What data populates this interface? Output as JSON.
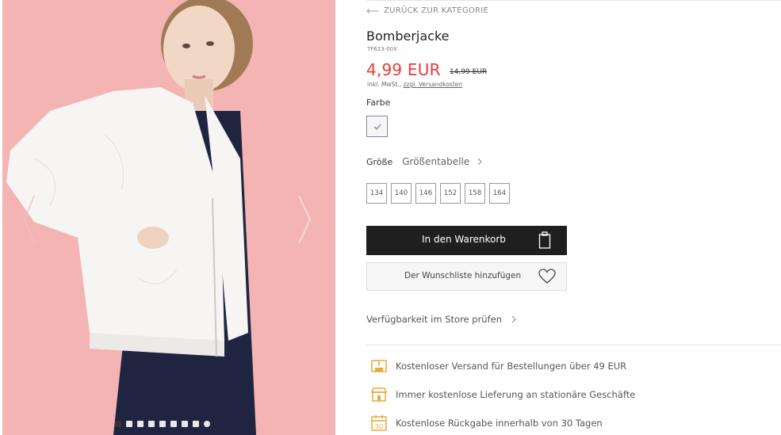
{
  "navigation": {
    "back_label": "ZURÜCK ZUR KATEGORIE"
  },
  "product": {
    "title": "Bomberjacke",
    "sku": "TF623-00X",
    "price": "4,99 EUR",
    "old_price": "14,99 EUR",
    "tax_text": "inkl. MwSt.,",
    "shipping_link": "zzgl. Versandkosten"
  },
  "color": {
    "label": "Farbe",
    "selected": "white"
  },
  "size": {
    "label": "Größe",
    "table_link": "Größentabelle",
    "options": [
      "134",
      "140",
      "146",
      "152",
      "158",
      "164"
    ]
  },
  "actions": {
    "add_to_cart": "In den Warenkorb",
    "add_to_wishlist": "Der Wunschliste hinzufügen",
    "store_availability": "Verfügbarkeit im Store prüfen"
  },
  "benefits": [
    {
      "icon": "truck-box-icon",
      "text": "Kostenloser Versand für Bestellungen über 49 EUR"
    },
    {
      "icon": "store-icon",
      "text": "Immer kostenlose Lieferung an stationäre Geschäfte"
    },
    {
      "icon": "calendar-30-icon",
      "text": "Kostenlose Rückgabe innerhalb von 30 Tagen"
    }
  ],
  "gallery": {
    "slide_count": 9,
    "active_index": 0
  },
  "colors": {
    "price_red": "#e83a3a",
    "icon_gold": "#e8a93a",
    "button_dark": "#1f1f1f",
    "background_pink": "#f3b2b2"
  }
}
